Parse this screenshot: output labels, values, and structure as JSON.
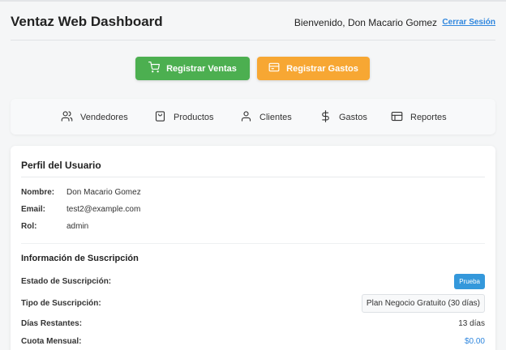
{
  "header": {
    "title": "Ventaz Web Dashboard",
    "welcome": "Bienvenido, Don Macario Gomez",
    "logout": "Cerrar Sesión"
  },
  "actions": {
    "ventas_label": "Registrar Ventas",
    "gastos_label": "Registrar Gastos"
  },
  "nav": {
    "vendedores": "Vendedores",
    "productos": "Productos",
    "clientes": "Clientes",
    "gastos": "Gastos",
    "reportes": "Reportes"
  },
  "profile": {
    "title": "Perfil del Usuario",
    "nombre_label": "Nombre:",
    "nombre": "Don Macario Gomez",
    "email_label": "Email:",
    "email": "test2@example.com",
    "rol_label": "Rol:",
    "rol": "admin"
  },
  "subscription": {
    "title": "Información de Suscripción",
    "estado_label": "Estado de Suscripción:",
    "estado": "Prueba",
    "tipo_label": "Tipo de Suscripción:",
    "tipo": "Plan Negocio Gratuito (30 días)",
    "dias_label": "Días Restantes:",
    "dias": "13 días",
    "cuota_label": "Cuota Mensual:",
    "cuota": "$0.00"
  },
  "colors": {
    "ventas": "#4caf50",
    "gastos": "#f7a733",
    "accent": "#2e86de",
    "badge": "#3498db"
  }
}
